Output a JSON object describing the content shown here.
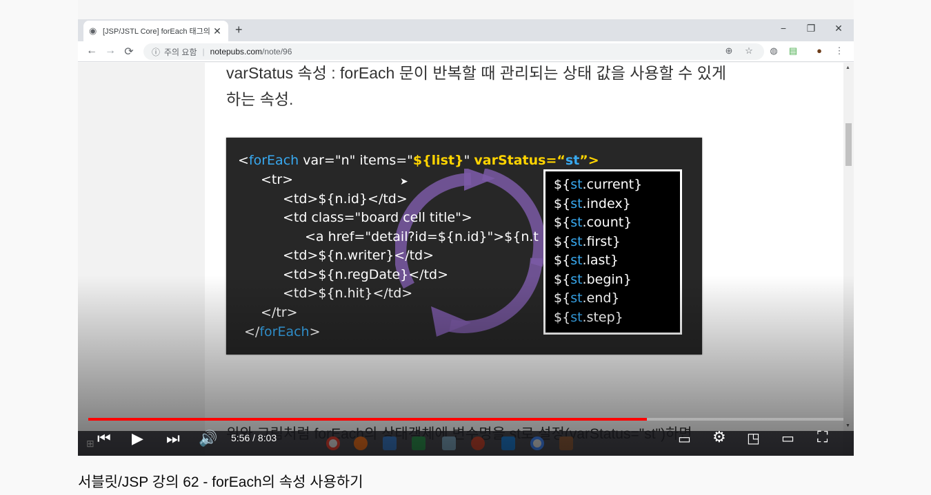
{
  "browser": {
    "tab_title": "[JSP/JSTL Core] forEach 태그의 ...",
    "new_tab": "+",
    "minimize": "−",
    "restore": "❐",
    "close": "✕",
    "back": "←",
    "forward": "→",
    "reload": "⟳",
    "security_label": "주의 요함",
    "url_host": "notepubs.com",
    "url_path": "/note/96"
  },
  "article": {
    "para1": "varStatus 속성 :  forEach 문이 반복할 때 관리되는 상태 값을 사용할 수 있게",
    "para2": "하는 속성.",
    "para3": "위와 그림처럼 forEach의 상태객체에 변수명을 st로 설정(varStatus=\"st\")하면"
  },
  "slide": {
    "line1_open": "<",
    "line1_tag": "forEach",
    "line1_attrs": " var=\"n\" items=\"",
    "line1_expr": "${list}",
    "line1_q": "\" ",
    "line1_vs": "varStatus",
    "line1_eq": "=“",
    "line1_st": "st",
    "line1_close": "”>",
    "line2": "<tr>",
    "line3": "<td>${n.id}</td>",
    "line4": "<td class=\"board cell title\">",
    "line5": "<a href=\"detail?id=${n.id}\">${n.title}",
    "line6": "<td>${n.writer}</td>",
    "line7": "<td>${n.regDate}</td>",
    "line8": "<td>${n.hit}</td>",
    "line9": "</tr>",
    "line10_open": "</",
    "line10_tag": "forEach",
    "line10_close": ">",
    "props": [
      {
        "pre": "${",
        "st": "st",
        "post": ".current}"
      },
      {
        "pre": "${",
        "st": "st",
        "post": ".index}"
      },
      {
        "pre": "${",
        "st": "st",
        "post": ".count}"
      },
      {
        "pre": "${",
        "st": "st",
        "post": ".first}"
      },
      {
        "pre": "${",
        "st": "st",
        "post": ".last}"
      },
      {
        "pre": "${",
        "st": "st",
        "post": ".begin}"
      },
      {
        "pre": "${",
        "st": "st",
        "post": ".end}"
      },
      {
        "pre": "${",
        "st": "st",
        "post": ".step}"
      }
    ]
  },
  "player": {
    "time": "5:56 / 8:03",
    "progress_fraction": 0.74,
    "colors": {
      "progress": "#ff0000"
    }
  },
  "video_title": "서블릿/JSP 강의 62 - forEach의 속성 사용하기"
}
